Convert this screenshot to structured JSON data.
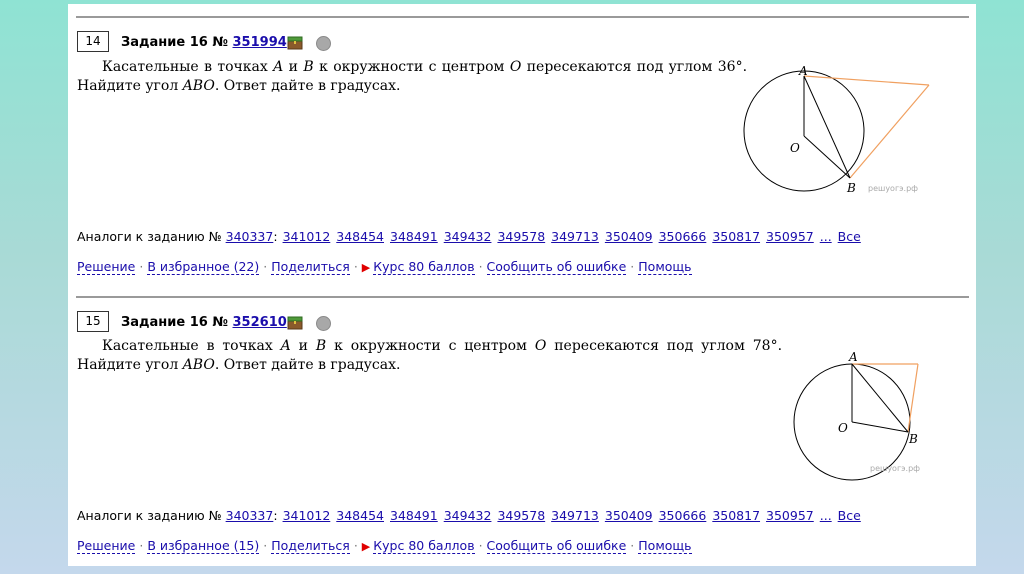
{
  "tasks": [
    {
      "number": "14",
      "title_prefix": "Задание 16 №",
      "id": "351994",
      "text_before_A": "Касательные в точках ",
      "pt_A": "A",
      "text_and": " и ",
      "pt_B": "B",
      "text_mid": " к окружности с центром ",
      "pt_O": "O",
      "text_angle": " пересекаются под углом 36°. Найдите угол ",
      "abo": "ABO",
      "text_end": ". Ответ дайте в градусах.",
      "figure": {
        "label_A": "A",
        "label_O": "O",
        "label_B": "B",
        "watermark": "решуогэ.рф",
        "angle_deg": 36
      },
      "analogs_label": "Аналоги к заданию №",
      "analogs_main": "340337",
      "analogs_colon": ":",
      "analogs": [
        "341012",
        "348454",
        "348491",
        "349432",
        "349578",
        "349713",
        "350409",
        "350666",
        "350817",
        "350957"
      ],
      "more": "...",
      "all": "Все",
      "links": {
        "solution": "Решение",
        "favorites": "В избранное (22)",
        "share": "Поделиться",
        "course": "Курс 80 баллов",
        "report": "Сообщить об ошибке",
        "help": "Помощь"
      }
    },
    {
      "number": "15",
      "title_prefix": "Задание 16 №",
      "id": "352610",
      "text_before_A": "Касательные в точках ",
      "pt_A": "A",
      "text_and": " и ",
      "pt_B": "B",
      "text_mid": " к окружности с центром ",
      "pt_O": "O",
      "text_angle": " пересекаются под углом 78°. Найдите угол ",
      "abo": "ABO",
      "text_end": ". Ответ дайте в градусах.",
      "figure": {
        "label_A": "A",
        "label_O": "O",
        "label_B": "B",
        "watermark": "решуогэ.рф",
        "angle_deg": 78
      },
      "analogs_label": "Аналоги к заданию №",
      "analogs_main": "340337",
      "analogs_colon": ":",
      "analogs": [
        "341012",
        "348454",
        "348491",
        "349432",
        "349578",
        "349713",
        "350409",
        "350666",
        "350817",
        "350957"
      ],
      "more": "...",
      "all": "Все",
      "links": {
        "solution": "Решение",
        "favorites": "В избранное (15)",
        "share": "Поделиться",
        "course": "Курс 80 баллов",
        "report": "Сообщить об ошибке",
        "help": "Помощь"
      }
    }
  ],
  "colors": {
    "tangent": "#f0a060",
    "link": "#1a0dab",
    "course_arrow": "#e00000"
  }
}
